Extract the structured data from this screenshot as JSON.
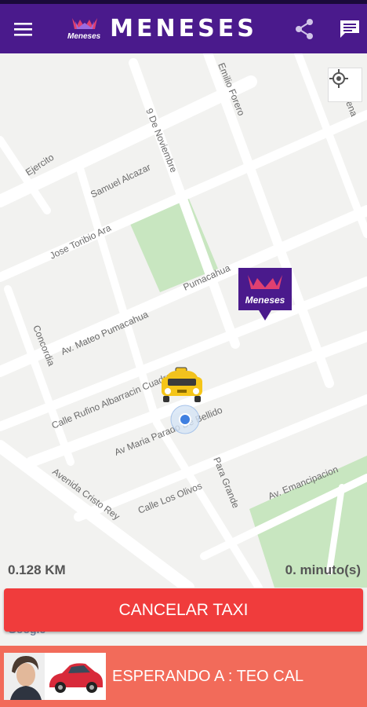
{
  "app": {
    "title": "MENESES",
    "logo_text": "Meneses",
    "logo_mark": "GMG"
  },
  "header": {
    "menu_icon": "hamburger-menu-icon",
    "share_icon": "share-icon",
    "chat_icon": "chat-message-icon"
  },
  "map": {
    "streets": [
      "Ejercito",
      "Samuel Alcazar",
      "9 De Noviembre",
      "Emilio Forero",
      "Jose Toribio Ara",
      "Pumacahua",
      "Av. Mateo Pumacahua",
      "Concordia",
      "Calle Rufino Albarracin Cuadra",
      "Av Maria Parado De Bellido",
      "Avenida Cristo Rey",
      "Calle Los Olivos",
      "Para Grande",
      "Av. Emancipacion",
      "lena"
    ],
    "marker_label": "Meneses",
    "marker_mark": "GMG",
    "locate_icon": "my-location-icon",
    "park_color": "#c8e6c0",
    "road_color": "#ffffff",
    "attribution": "Google"
  },
  "trip": {
    "distance": "0.128 KM",
    "eta": "0. minuto(s)"
  },
  "actions": {
    "cancel_label": "CANCELAR TAXI"
  },
  "driver": {
    "status_text": "ESPERANDO A : TEO CAL"
  },
  "colors": {
    "primary": "#4a1a8c",
    "cancel": "#f03c3c",
    "bottom_bar": "#f26b5a"
  }
}
